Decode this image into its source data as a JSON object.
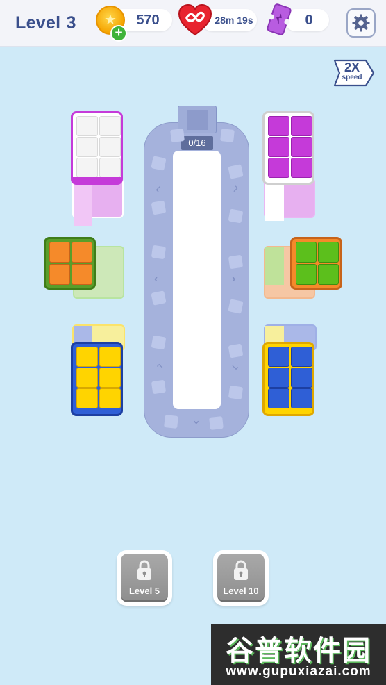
{
  "header": {
    "level_word": "Level",
    "level_number": "3",
    "coins": "570",
    "lives_timer": "28m 19s",
    "tickets": "0",
    "icons": {
      "coin": "coin-icon",
      "add": "plus-icon",
      "lives": "infinite-heart-icon",
      "ticket": "ticket-icon",
      "settings": "gear-icon"
    }
  },
  "speed_button": {
    "big": "2X",
    "small": "speed"
  },
  "conveyor": {
    "counter": "0/16"
  },
  "locked_levels": [
    {
      "label": "Level 5"
    },
    {
      "label": "Level 10"
    }
  ],
  "watermark": {
    "title": "谷普软件园",
    "url": "www.gupuxiazai.com"
  },
  "colors": {
    "white": "#ffffff",
    "magenta": "#c53ad9",
    "orange": "#f58a2a",
    "green": "#5cbf1c",
    "yellow": "#ffd400",
    "blue": "#2f5fd6",
    "track": "#a5b2dc",
    "background": "#cfeaf8"
  }
}
